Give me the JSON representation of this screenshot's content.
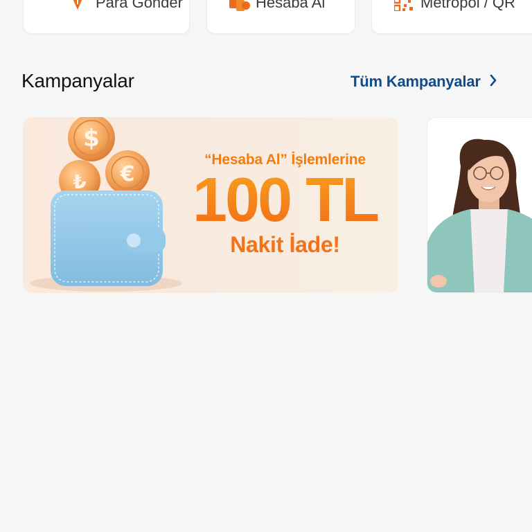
{
  "quick_actions": [
    {
      "label": "Para Gönder",
      "icon": "send-money-icon"
    },
    {
      "label": "Hesaba Al",
      "icon": "receive-money-icon"
    },
    {
      "label": "Metropol / QR",
      "icon": "qr-code-icon"
    }
  ],
  "campaigns": {
    "title": "Kampanyalar",
    "see_all": "Tüm Kampanyalar",
    "banner": {
      "line1": "“Hesaba Al” İşlemlerine",
      "line2": "100 TL",
      "line3": "Nakit İade!"
    }
  },
  "colors": {
    "accent_orange": "#f47a14",
    "link_blue": "#0e4c8a",
    "background": "#f6f6f6"
  }
}
